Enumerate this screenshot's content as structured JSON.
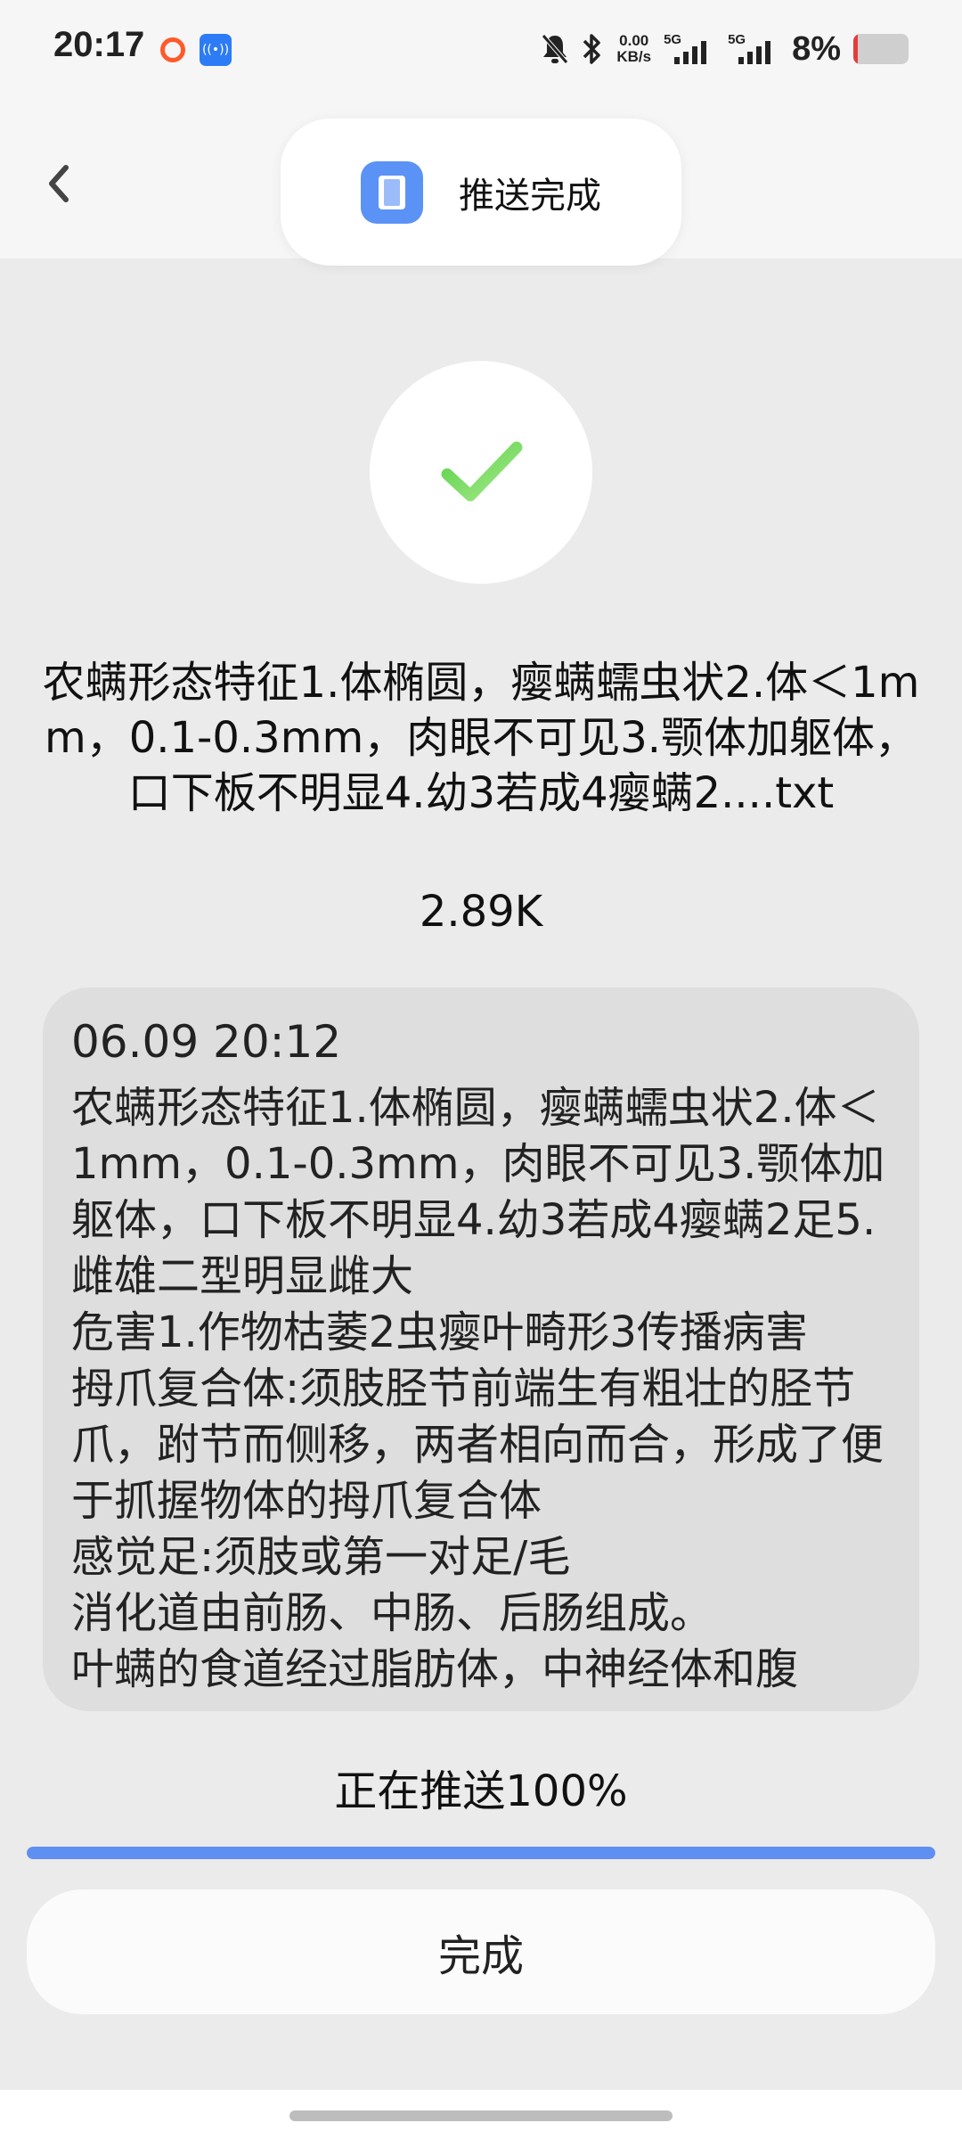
{
  "status_bar": {
    "time": "20:17",
    "net_speed_value": "0.00",
    "net_speed_unit": "KB/s",
    "sim1_label": "5G",
    "sim2_label": "5G",
    "battery_percent": "8%",
    "battery_level": 0.08,
    "icons": [
      "ring-notification-icon",
      "hotspot-badge-icon",
      "mute-bell-icon",
      "bluetooth-icon",
      "signal-icon",
      "battery-icon"
    ]
  },
  "header": {
    "title": "推送完成",
    "back_icon": "chevron-left-icon"
  },
  "success": {
    "icon": "check-icon",
    "icon_color": "#7ad95c"
  },
  "file": {
    "name": "农螨形态特征1.体椭圆，瘿螨蠕虫状2.体＜1mm，0.1-0.3mm，肉眼不可见3.颚体加躯体，口下板不明显4.幼3若成4瘿螨2....txt",
    "size": "2.89K"
  },
  "preview": {
    "date": "06.09 20:12",
    "body": "农螨形态特征1.体椭圆，瘿螨蠕虫状2.体＜1mm，0.1-0.3mm，肉眼不可见3.颚体加躯体，口下板不明显4.幼3若成4瘿螨2足5.雌雄二型明显雌大\n危害1.作物枯萎2虫瘿叶畸形3传播病害\n拇爪复合体:须肢胫节前端生有粗壮的胫节爪，跗节而侧移，两者相向而合，形成了便于抓握物体的拇爪复合体\n感觉足:须肢或第一对足/毛\n消化道由前肠、中肠、后肠组成。\n叶螨的食道经过脂肪体，中神经体和腹"
  },
  "progress": {
    "label": "正在推送100%",
    "value": 1.0,
    "bar_color": "#5f8ff0"
  },
  "actions": {
    "done_label": "完成"
  }
}
